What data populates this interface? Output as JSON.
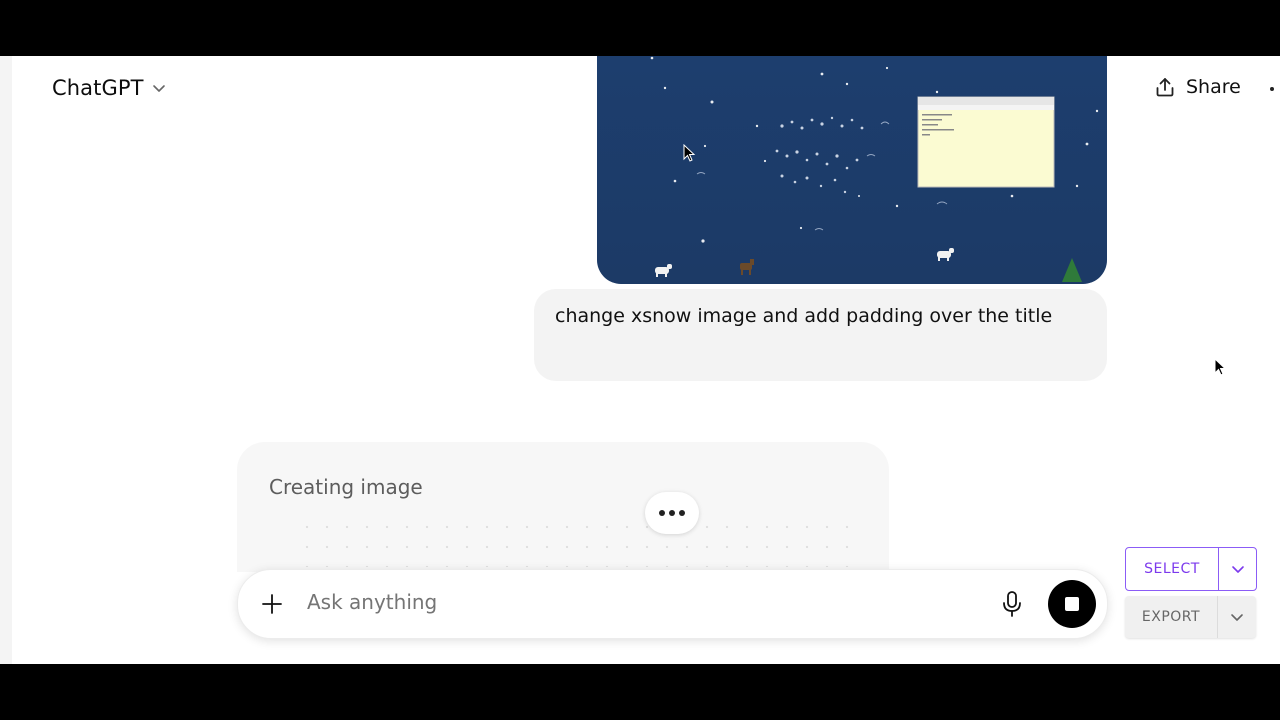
{
  "header": {
    "title": "ChatGPT",
    "share_label": "Share"
  },
  "conversation": {
    "user_message": "change xsnow image and add padding over the title",
    "assistant_status": "Creating image"
  },
  "composer": {
    "placeholder": "Ask anything"
  },
  "side_controls": {
    "select_label": "SELECT",
    "export_label": "EXPORT"
  },
  "icons": {
    "model_menu": "chevron-down-icon",
    "share": "share-icon",
    "attach": "plus-icon",
    "voice": "microphone-icon",
    "stop": "stop-icon",
    "more": "ellipsis-icon"
  },
  "colors": {
    "accent": "#7c3aed",
    "image_bg": "#1d3e6e",
    "bubble": "#f3f3f3"
  }
}
